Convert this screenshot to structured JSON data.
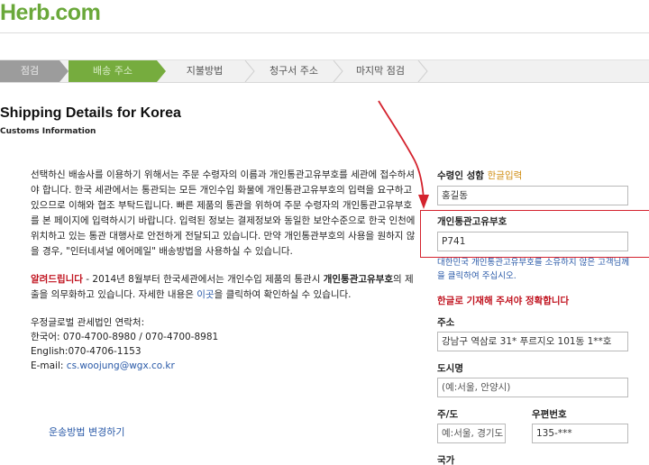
{
  "header": {
    "logo": "Herb.com"
  },
  "steps": [
    {
      "label": "점검",
      "state": "done"
    },
    {
      "label": "배송 주소",
      "state": "active"
    },
    {
      "label": "지불방법",
      "state": "pending"
    },
    {
      "label": "청구서 주소",
      "state": "pending"
    },
    {
      "label": "마지막 점검",
      "state": "pending"
    }
  ],
  "page": {
    "title": "Shipping Details for Korea",
    "subtitle": "Customs Information"
  },
  "left": {
    "intro": "선택하신 배송사를 이용하기 위해서는 주문 수령자의 이름과 개인통관고유부호를 세관에 접수하셔야 합니다. 한국 세관에서는 통관되는 모든 개인수입 화물에 개인통관고유부호의 입력을 요구하고 있으므로 이해와 협조 부탁드립니다. 빠른 제품의 통관을 위하여 주문 수령자의 개인통관고유부호를 본 페이지에 입력하시기 바랍니다. 입력된 정보는 결제정보와 동일한 보안수준으로 한국 인천에 위치하고 있는 통관 대행사로 안전하게 전달되고 있습니다. 만약 개인통관부호의 사용을 원하지 않을 경우, \"인터네셔널 에어메일\" 배송방법을 사용하실 수 있습니다.",
    "notice_label": "알려드립니다",
    "notice_text_1": " - 2014년 8월부터 한국세관에서는 개인수입 제품의 통관시 ",
    "notice_bold": "개인통관고유부호",
    "notice_text_2": "의 제출을 의무화하고 있습니다. 자세한 내용은 ",
    "notice_link": "이곳",
    "notice_text_3": "을 클릭하여 확인하실 수 있습니다.",
    "contact_title": "우정글로벌 관세법인 연락처:",
    "contact_korean": "한국어: 070-4700-8980 / 070-4700-8981",
    "contact_english": "English:070-4706-1153",
    "contact_email_label": "E-mail: ",
    "contact_email": "cs.woojung@wgx.co.kr",
    "change_shipping": "운송방법 변경하기"
  },
  "form": {
    "recipient_label": "수령인 성함",
    "recipient_label_hint": "한글입력",
    "recipient_value": "홍길동",
    "customs_label": "개인통관고유부호",
    "customs_value": "P741",
    "customs_hint_1": "대한민국 개인통관고유부호를 소유하지 않은 고객님께",
    "customs_hint_2": "을 클릭하여 주십시오.",
    "korean_warning": "한글로 기재해 주셔야 정확합니다",
    "address_label": "주소",
    "address_value": "강남구 역삼로 31* 푸르지오 101동 1**호",
    "city_label": "도시명",
    "city_placeholder": "(예:서울, 안양시)",
    "state_label": "주/도",
    "state_placeholder": "예:서울, 경기도",
    "zip_label": "우편번호",
    "zip_value": "135-***",
    "country_label": "국가"
  },
  "colors": {
    "logo": "#6aa83a",
    "step_done": "#9c9c9c",
    "step_active": "#76ac3e",
    "highlight_red": "#d4232e",
    "link_blue": "#2a5aa8"
  }
}
